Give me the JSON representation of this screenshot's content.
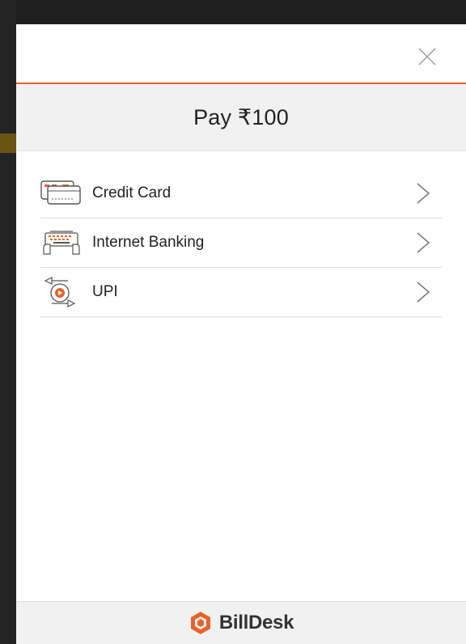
{
  "header": {
    "close_icon": "close-icon"
  },
  "payment": {
    "title": "Pay ₹100"
  },
  "options": [
    {
      "label": "Credit Card",
      "icon": "credit-card-icon"
    },
    {
      "label": "Internet Banking",
      "icon": "internet-banking-icon"
    },
    {
      "label": "UPI",
      "icon": "upi-icon"
    }
  ],
  "footer": {
    "brand": "BillDesk",
    "logo_icon": "billdesk-logo-icon"
  },
  "colors": {
    "accent": "#e8632b",
    "text": "#222222",
    "panel": "#f1f1f1"
  }
}
